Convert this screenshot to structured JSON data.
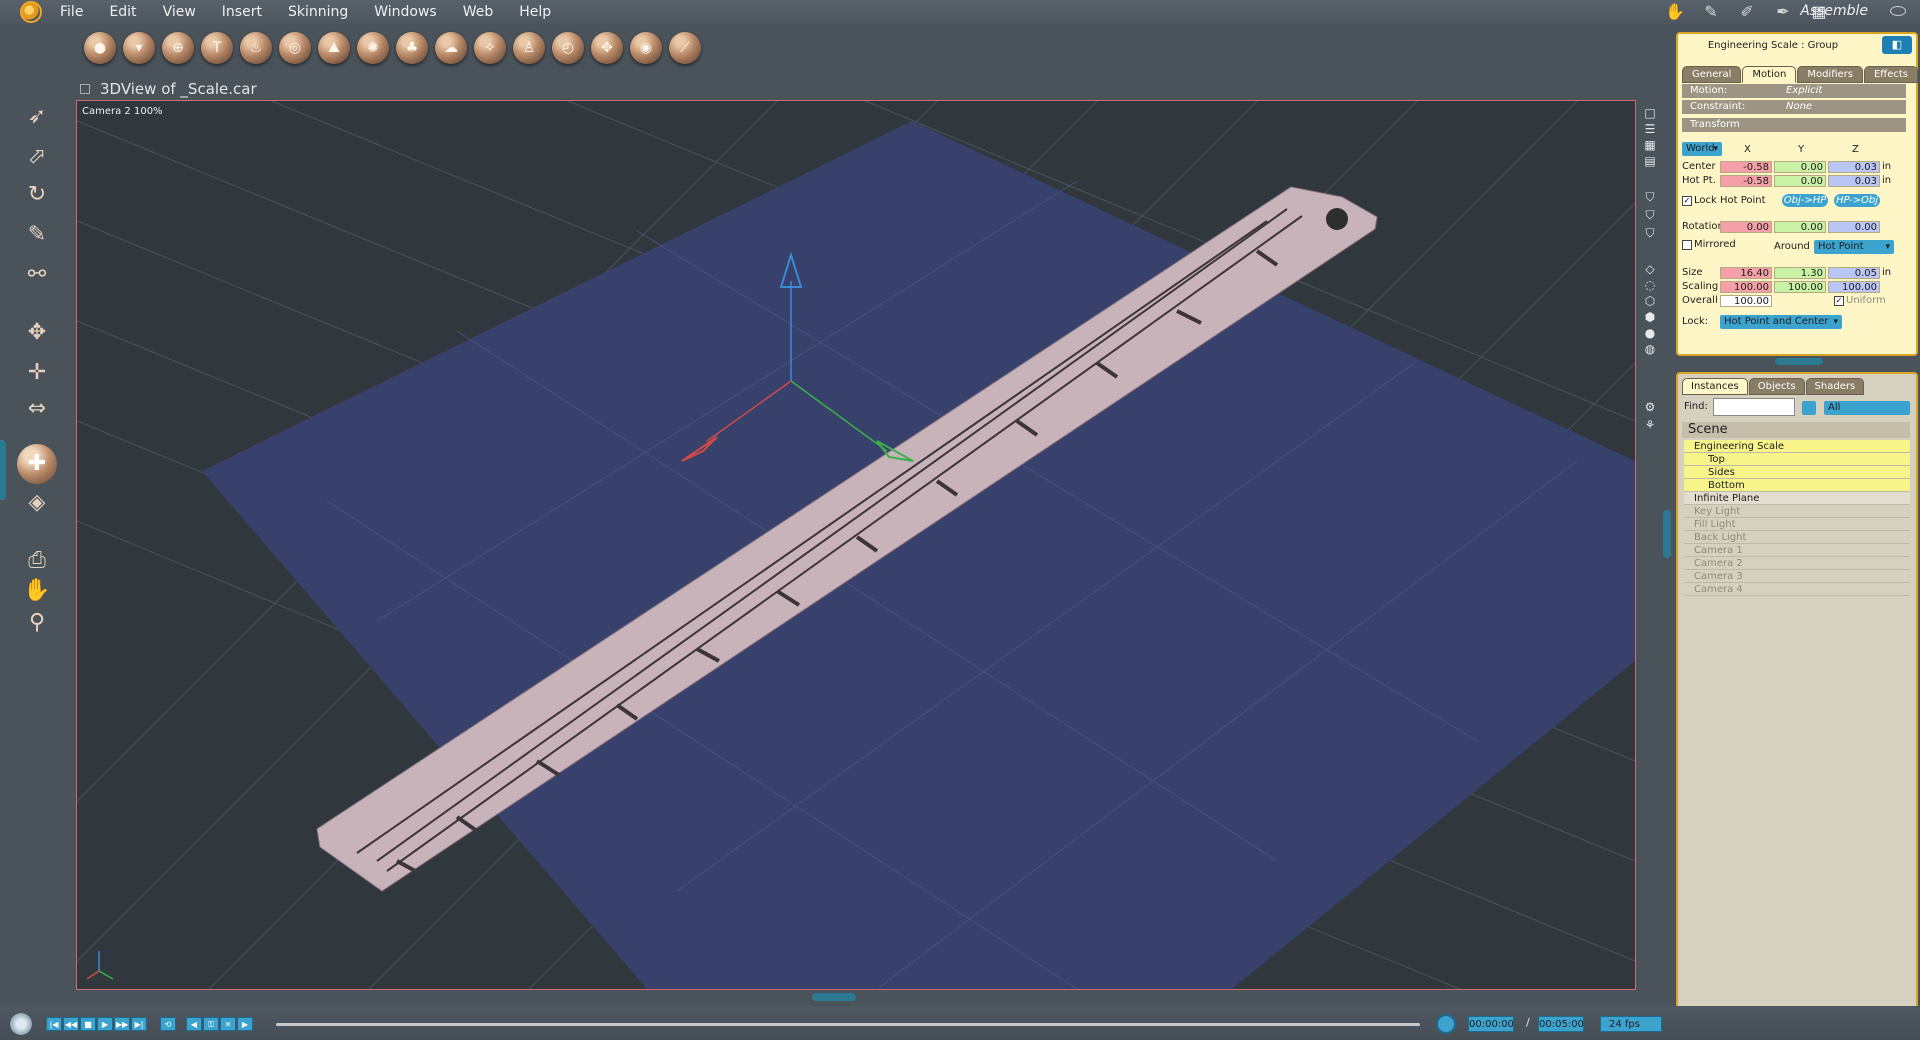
{
  "menu": {
    "items": [
      "File",
      "Edit",
      "View",
      "Insert",
      "Skinning",
      "Windows",
      "Web",
      "Help"
    ],
    "room_label": "Assemble"
  },
  "toolbar": {
    "icons": [
      "sphere-icon",
      "cone-icon",
      "globe-icon",
      "text-icon",
      "flame-icon",
      "torus-icon",
      "terrain-icon",
      "cog-icon",
      "tree-icon",
      "cloud-icon",
      "fire-icon",
      "figure-icon",
      "clock-icon",
      "puzzle-icon",
      "ring-icon",
      "wand-icon"
    ]
  },
  "document": {
    "title": "3DView of _Scale.car",
    "camera_label": "Camera 2 100%"
  },
  "properties": {
    "title": "Engineering Scale : Group",
    "tabs": [
      "General",
      "Motion",
      "Modifiers",
      "Effects"
    ],
    "active_tab": "Motion",
    "motion_label": "Motion:",
    "motion_value": "Explicit",
    "constraint_label": "Constraint:",
    "constraint_value": "None",
    "transform_label": "Transform",
    "space": "World",
    "axes": [
      "X",
      "Y",
      "Z"
    ],
    "center_label": "Center",
    "center": [
      "-0.58",
      "0.00",
      "0.03"
    ],
    "hotpt_label": "Hot Pt.",
    "hotpt": [
      "-0.58",
      "0.00",
      "0.03"
    ],
    "unit": "in",
    "lock_hot_point": "Lock Hot Point",
    "obj_hp": "Obj->HP",
    "hp_obj": "HP->Obj",
    "rotation_label": "Rotation",
    "rotation": [
      "0.00",
      "0.00",
      "0.00"
    ],
    "mirrored": "Mirrored",
    "around_label": "Around",
    "around_value": "Hot Point",
    "size_label": "Size",
    "size": [
      "16.40",
      "1.30",
      "0.05"
    ],
    "scaling_label": "Scaling",
    "scaling": [
      "100.00",
      "100.00",
      "100.00"
    ],
    "overall_label": "Overall",
    "overall": "100.00",
    "uniform": "Uniform",
    "lock_label": "Lock:",
    "lock_value": "Hot Point and Center"
  },
  "scene": {
    "tabs": [
      "Instances",
      "Objects",
      "Shaders"
    ],
    "active_tab": "Instances",
    "find_label": "Find:",
    "filter_value": "All",
    "header": "Scene",
    "items": [
      {
        "label": "Engineering Scale",
        "state": "sel",
        "indent": 0
      },
      {
        "label": "Top",
        "state": "sel",
        "indent": 1
      },
      {
        "label": "Sides",
        "state": "sel",
        "indent": 1
      },
      {
        "label": "Bottom",
        "state": "sel",
        "indent": 1
      },
      {
        "label": "Infinite Plane",
        "state": "plane",
        "indent": 0
      },
      {
        "label": "Key Light",
        "state": "dim",
        "indent": 0
      },
      {
        "label": "Fill Light",
        "state": "dim",
        "indent": 0
      },
      {
        "label": "Back Light",
        "state": "dim",
        "indent": 0
      },
      {
        "label": "Camera 1",
        "state": "dim",
        "indent": 0
      },
      {
        "label": "Camera 2",
        "state": "dim",
        "indent": 0
      },
      {
        "label": "Camera 3",
        "state": "dim",
        "indent": 0
      },
      {
        "label": "Camera 4",
        "state": "dim",
        "indent": 0
      }
    ]
  },
  "timeline": {
    "current_time": "00:00:00",
    "separator": "/",
    "end_time": "00:05:00",
    "fps": "24 fps"
  },
  "colors": {
    "panel_bg": "#fff6c8",
    "panel_border": "#d9a526",
    "accent": "#3ca3cf",
    "ground_plane": "#39406f",
    "ruler": "#c9b3bb"
  }
}
